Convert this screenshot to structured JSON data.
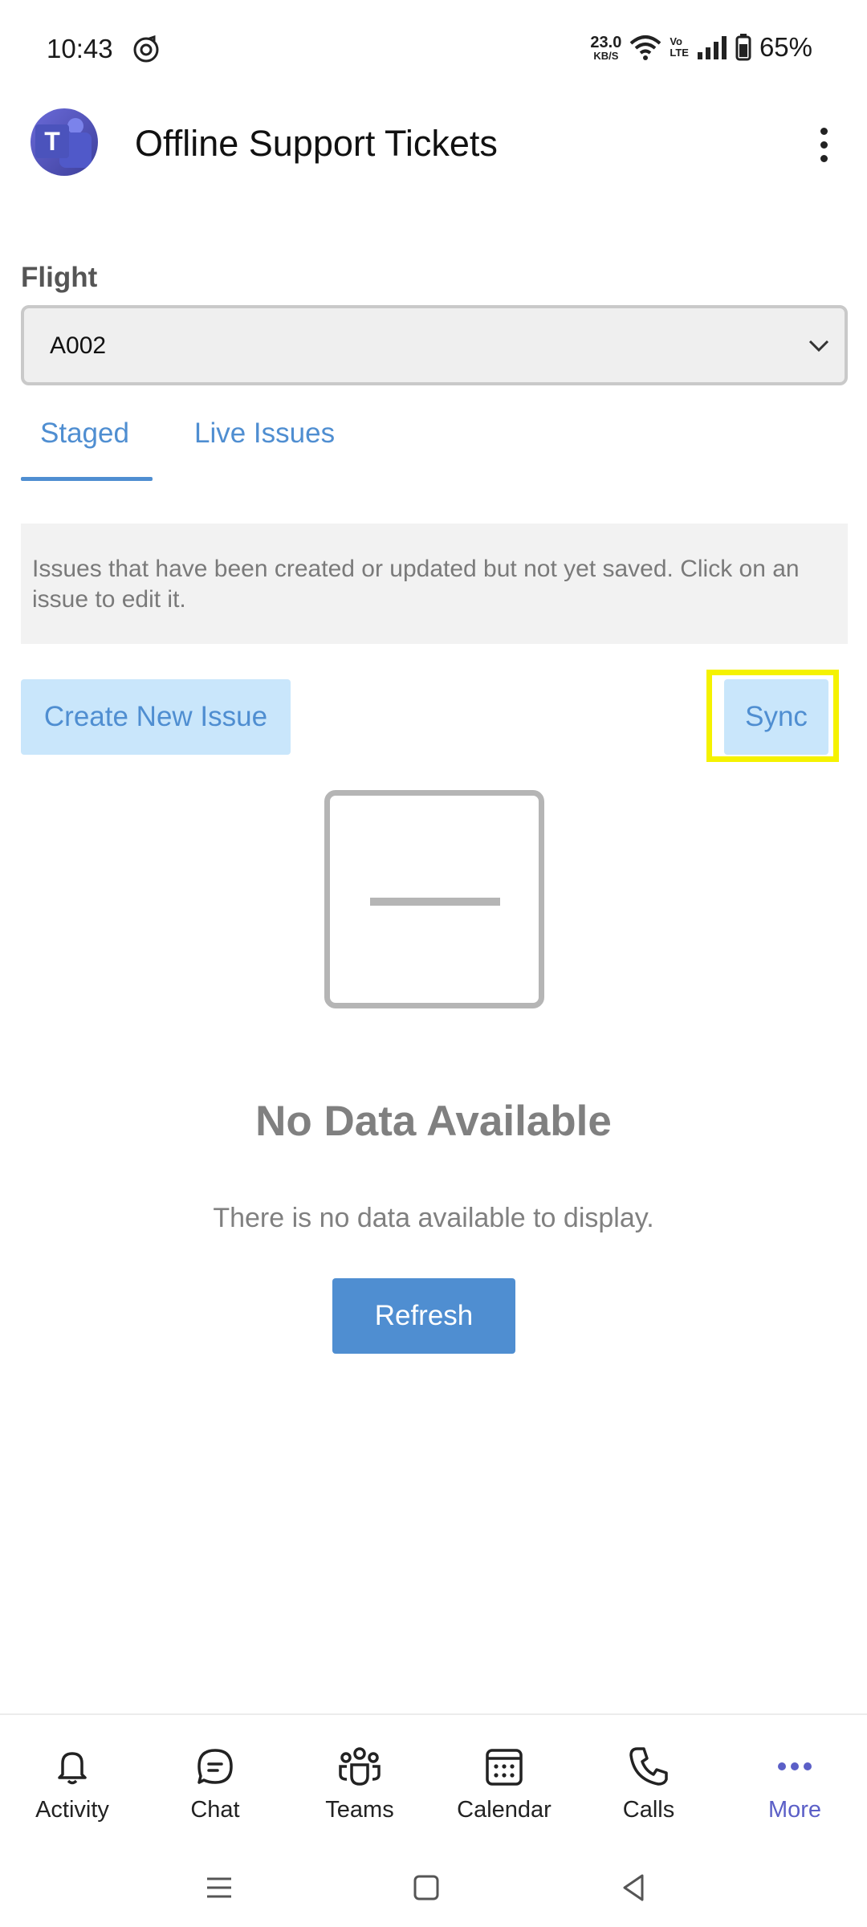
{
  "status_bar": {
    "time": "10:43",
    "net_speed_value": "23.0",
    "net_speed_unit": "KB/S",
    "volte_top": "Vo",
    "volte_bottom": "LTE",
    "battery": "65%"
  },
  "header": {
    "title": "Offline Support Tickets",
    "avatar_letter": "T"
  },
  "flight": {
    "label": "Flight",
    "value": "A002"
  },
  "tabs": [
    {
      "label": "Staged",
      "active": true
    },
    {
      "label": "Live Issues",
      "active": false
    }
  ],
  "info": {
    "text": "Issues that have been created or updated but not yet saved. Click on an issue to edit it."
  },
  "actions": {
    "create_label": "Create New Issue",
    "sync_label": "Sync"
  },
  "empty_state": {
    "title": "No Data Available",
    "description": "There is no data available to display.",
    "refresh_label": "Refresh"
  },
  "bottom_nav": [
    {
      "label": "Activity",
      "icon": "bell-icon"
    },
    {
      "label": "Chat",
      "icon": "chat-icon"
    },
    {
      "label": "Teams",
      "icon": "teams-icon"
    },
    {
      "label": "Calendar",
      "icon": "calendar-icon"
    },
    {
      "label": "Calls",
      "icon": "phone-icon"
    },
    {
      "label": "More",
      "icon": "more-icon",
      "active": true
    }
  ],
  "colors": {
    "accent": "#4f8ed1",
    "button_light": "#c9e6fb",
    "highlight": "#f5f200",
    "nav_active": "#5b5fc7"
  }
}
